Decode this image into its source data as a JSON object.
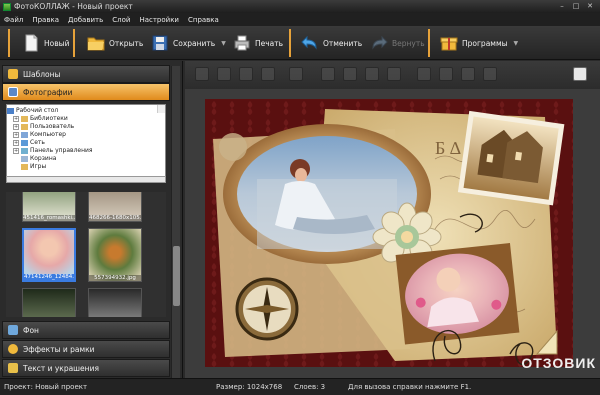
{
  "window": {
    "title": "ФотоКОЛЛАЖ - Новый проект"
  },
  "menu": [
    "Файл",
    "Правка",
    "Добавить",
    "Слой",
    "Настройки",
    "Справка"
  ],
  "toolbar": {
    "new": "Новый",
    "open": "Открыть",
    "save": "Сохранить",
    "print": "Печать",
    "undo": "Отменить",
    "redo": "Вернуть",
    "programs": "Программы"
  },
  "panel": {
    "templates": "Шаблоны",
    "photos": "Фотографии",
    "background": "Фон",
    "effects": "Эффекты и рамки",
    "text": "Текст и украшения"
  },
  "tree": [
    "Рабочий стол",
    "Библиотеки",
    "Пользователь",
    "Компьютер",
    "Сеть",
    "Панель управления",
    "Корзина",
    "Игры"
  ],
  "thumbs": [
    "451416_romashki...",
    "468266-1680x105...",
    "47141246_12484...",
    "557394932.jpg",
    "",
    ""
  ],
  "status": {
    "project": "Проект: Новый проект",
    "size": "Размер: 1024x768",
    "layers": "Слоев: 3",
    "help": "Для вызова справки нажмите F1."
  },
  "watermark": "ОТЗОВИК",
  "colors": {
    "accent": "#e08a1c",
    "selection": "#3a7be0",
    "canvas_bg": "#5a1010"
  }
}
